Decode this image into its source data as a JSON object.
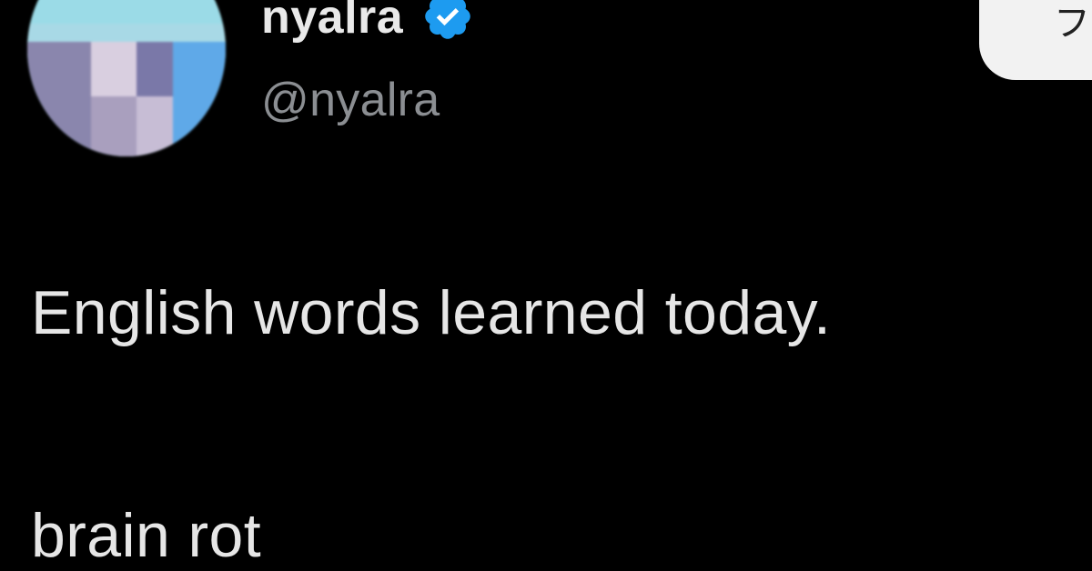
{
  "post": {
    "author": {
      "display_name": "nyalra",
      "handle": "@nyalra",
      "verified": true,
      "verified_icon": "verified-badge-icon",
      "avatar": "pixelated-avatar"
    },
    "follow_button": {
      "label": "フ"
    },
    "text_lines": [
      "English words learned today.",
      "brain rot"
    ]
  },
  "colors": {
    "background": "#000000",
    "primary_text": "#e6e6e6",
    "secondary_text": "#8b8e92",
    "verified_blue": "#1d9bf0",
    "button_bg": "#f2f2f2"
  }
}
